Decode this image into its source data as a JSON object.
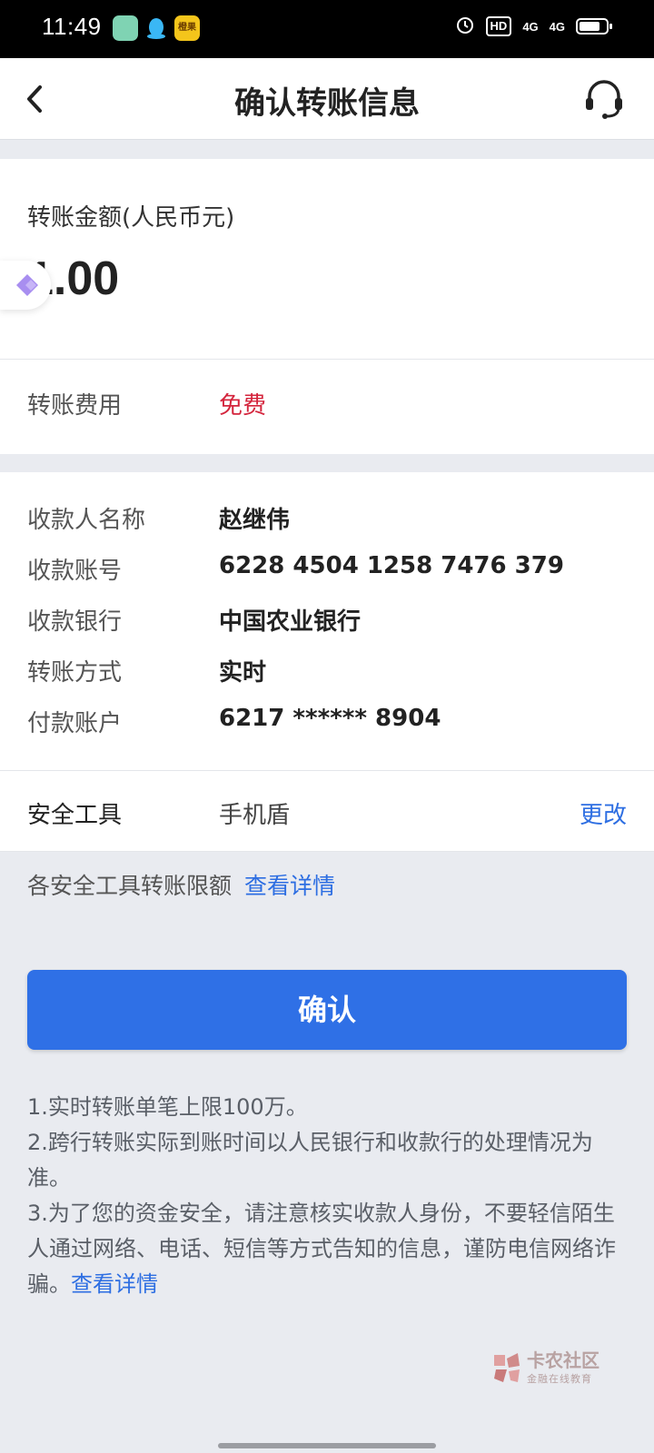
{
  "status_bar": {
    "time": "11:49",
    "app3_label": "橙果",
    "hd": "HD",
    "net1": "4G",
    "net2": "4G"
  },
  "header": {
    "title": "确认转账信息"
  },
  "amount": {
    "label": "转账金额(人民币元)",
    "value": "1.00"
  },
  "fee": {
    "label": "转账费用",
    "value": "免费"
  },
  "transfer_info": [
    {
      "label": "收款人名称",
      "value": "赵继伟"
    },
    {
      "label": "收款账号",
      "value": "6228 4504 1258 7476 379"
    },
    {
      "label": "收款银行",
      "value": "中国农业银行"
    },
    {
      "label": "转账方式",
      "value": "实时"
    },
    {
      "label": "付款账户",
      "value": "6217 ****** 8904"
    }
  ],
  "security": {
    "label": "安全工具",
    "value": "手机盾",
    "change": "更改"
  },
  "limit": {
    "text": "各安全工具转账限额",
    "link": "查看详情"
  },
  "confirm_button": "确认",
  "notes": {
    "line1": "1.实时转账单笔上限100万。",
    "line2": "2.跨行转账实际到账时间以人民银行和收款行的处理情况为准。",
    "line3": "3.为了您的资金安全，请注意核实收款人身份，不要轻信陌生人通过网络、电话、短信等方式告知的信息，谨防电信网络诈骗。",
    "link": "查看详情"
  },
  "watermark": {
    "title": "卡农社区",
    "subtitle": "金融在线教育"
  },
  "colors": {
    "primary": "#2f70e6",
    "link": "#2d6ee2",
    "free": "#d4253d",
    "background": "#e9ebf0"
  }
}
